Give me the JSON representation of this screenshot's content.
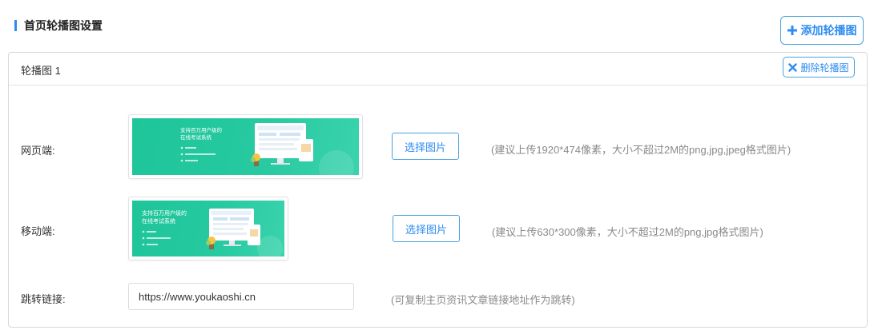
{
  "header": {
    "title": "首页轮播图设置",
    "add_label": "添加轮播图"
  },
  "card": {
    "title": "轮播图 1",
    "delete_label": "删除轮播图",
    "web": {
      "label": "网页端:",
      "select_label": "选择图片",
      "hint": "(建议上传1920*474像素，大小不超过2M的png,jpg,jpeg格式图片)",
      "banner_text": "支持百万用户级的在线考试系统",
      "banner_items": [
        "在线练习",
        "考试（在线考试、小程序）",
        "题库管理"
      ]
    },
    "mobile": {
      "label": "移动端:",
      "select_label": "选择图片",
      "hint": "(建议上传630*300像素，大小不超过2M的png,jpg格式图片)",
      "banner_text": "支持百万用户级的在线考试系统",
      "banner_items": [
        "在线练习",
        "考试（在线考试、小程序）",
        "题库管理"
      ]
    },
    "link": {
      "label": "跳转链接:",
      "value": "https://www.youkaoshi.cn",
      "hint": "(可复制主页资讯文章链接地址作为跳转)"
    }
  },
  "colors": {
    "accent": "#2d8cf0",
    "banner_green": "#26c9a0",
    "border": "#d8d8d8",
    "hint_gray": "#8a8a8a"
  },
  "icons": [
    "plus-icon",
    "close-icon"
  ]
}
